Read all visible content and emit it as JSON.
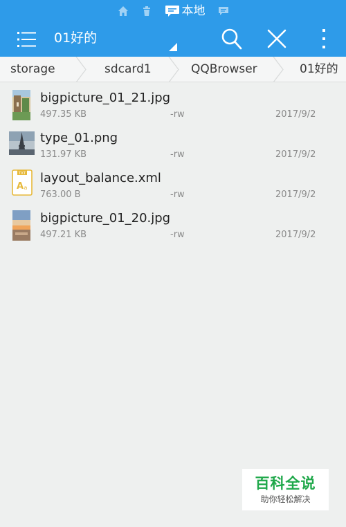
{
  "status_strip": {
    "local_label": "本地",
    "icons": [
      "home-icon",
      "trash-icon",
      "chat-icon",
      "message-icon"
    ]
  },
  "action_bar": {
    "title": "01好的",
    "menu_icon": "menu-icon",
    "search_icon": "search-icon",
    "close_icon": "close-icon",
    "more_icon": "more-vert-icon"
  },
  "breadcrumb": [
    "storage",
    "sdcard1",
    "QQBrowser",
    "01好的"
  ],
  "files": [
    {
      "name": "bigpicture_01_21.jpg",
      "size": "497.35 KB",
      "perm": "-rw",
      "date": "2017/9/2",
      "icon": "image-thumbnail-icon"
    },
    {
      "name": "type_01.png",
      "size": "131.97 KB",
      "perm": "-rw",
      "date": "2017/9/2",
      "icon": "image-thumbnail-icon"
    },
    {
      "name": "layout_balance.xml",
      "size": "763.00 B",
      "perm": "-rw",
      "date": "2017/9/2",
      "icon": "txt-file-icon"
    },
    {
      "name": "bigpicture_01_20.jpg",
      "size": "497.21 KB",
      "perm": "-rw",
      "date": "2017/9/2",
      "icon": "image-thumbnail-icon"
    }
  ],
  "watermark": {
    "title": "百科全说",
    "subtitle": "助你轻松解决"
  },
  "colors": {
    "accent": "#2e9be9",
    "background": "#eef0ef",
    "watermark_green": "#1fa84a"
  }
}
